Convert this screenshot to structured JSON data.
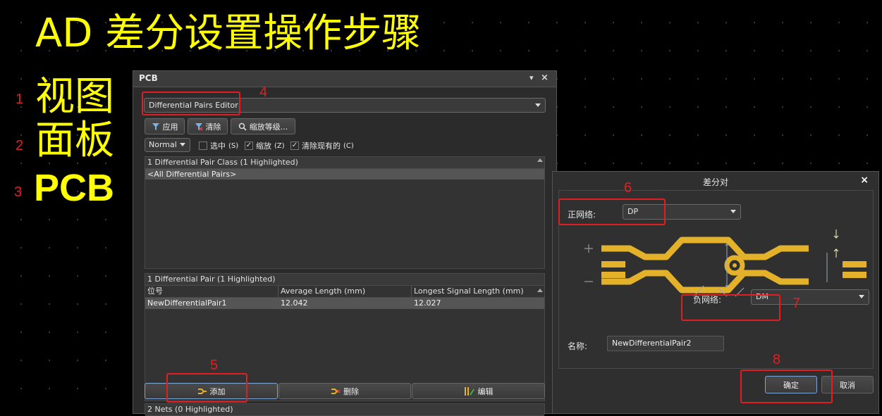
{
  "annotations": {
    "title": "AD 差分设置操作步骤",
    "side": [
      {
        "num": "1",
        "text": "视图"
      },
      {
        "num": "2",
        "text": "面板"
      },
      {
        "num": "3",
        "text": "PCB"
      }
    ],
    "steps": [
      "4",
      "5",
      "6",
      "7",
      "8"
    ]
  },
  "pcb_panel": {
    "title": "PCB",
    "pin_icon": "▾",
    "close_icon": "×",
    "editor_select": "Differential Pairs Editor",
    "toolbar": {
      "apply": "应用",
      "clear": "清除",
      "zoom_level": "缩放等级..."
    },
    "mode_select": "Normal",
    "checkboxes": [
      {
        "label": "选中",
        "key": "(S)",
        "checked": false
      },
      {
        "label": "缩放",
        "key": "(Z)",
        "checked": true
      },
      {
        "label": "清除现有的",
        "key": "(C)",
        "checked": true
      }
    ],
    "class_section": {
      "header": "1 Differential Pair Class (1 Highlighted)",
      "items": [
        "<All Differential Pairs>"
      ]
    },
    "pair_section": {
      "header": "1 Differential Pair (1 Highlighted)",
      "columns": [
        "位号",
        "Average Length (mm)",
        "Longest Signal Length (mm)"
      ],
      "rows": [
        [
          "NewDifferentialPair1",
          "12.042",
          "12.027"
        ]
      ]
    },
    "actions": {
      "add": "添加",
      "delete": "删除",
      "edit": "编辑"
    },
    "nets_section": {
      "header": "2 Nets (0 Highlighted)"
    }
  },
  "dialog": {
    "title": "差分对",
    "close": "×",
    "positive_label": "正网络:",
    "positive_value": "DP",
    "negative_label": "负网络:",
    "negative_value": "DM",
    "name_label": "名称:",
    "name_value": "NewDifferentialPair2",
    "ok": "确定",
    "cancel": "取消",
    "diagram": {
      "plus": "+",
      "minus": "—",
      "trace_color": "#e3b12a"
    }
  }
}
